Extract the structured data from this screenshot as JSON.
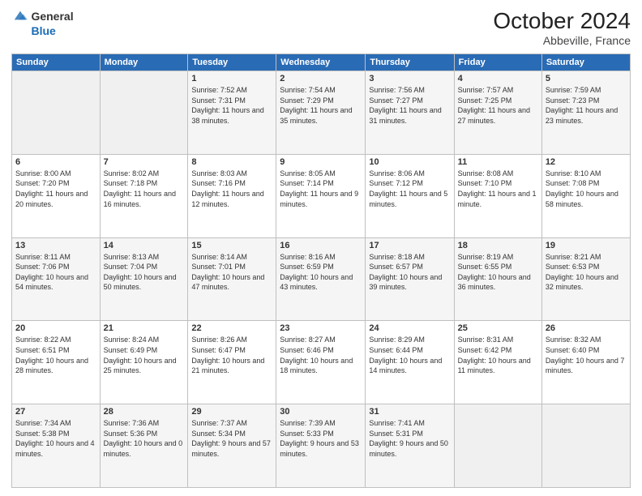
{
  "header": {
    "logo": {
      "general": "General",
      "blue": "Blue"
    },
    "title": "October 2024",
    "location": "Abbeville, France"
  },
  "days_header": [
    "Sunday",
    "Monday",
    "Tuesday",
    "Wednesday",
    "Thursday",
    "Friday",
    "Saturday"
  ],
  "weeks": [
    [
      {
        "day": "",
        "info": ""
      },
      {
        "day": "",
        "info": ""
      },
      {
        "day": "1",
        "sunrise": "Sunrise: 7:52 AM",
        "sunset": "Sunset: 7:31 PM",
        "daylight": "Daylight: 11 hours and 38 minutes."
      },
      {
        "day": "2",
        "sunrise": "Sunrise: 7:54 AM",
        "sunset": "Sunset: 7:29 PM",
        "daylight": "Daylight: 11 hours and 35 minutes."
      },
      {
        "day": "3",
        "sunrise": "Sunrise: 7:56 AM",
        "sunset": "Sunset: 7:27 PM",
        "daylight": "Daylight: 11 hours and 31 minutes."
      },
      {
        "day": "4",
        "sunrise": "Sunrise: 7:57 AM",
        "sunset": "Sunset: 7:25 PM",
        "daylight": "Daylight: 11 hours and 27 minutes."
      },
      {
        "day": "5",
        "sunrise": "Sunrise: 7:59 AM",
        "sunset": "Sunset: 7:23 PM",
        "daylight": "Daylight: 11 hours and 23 minutes."
      }
    ],
    [
      {
        "day": "6",
        "sunrise": "Sunrise: 8:00 AM",
        "sunset": "Sunset: 7:20 PM",
        "daylight": "Daylight: 11 hours and 20 minutes."
      },
      {
        "day": "7",
        "sunrise": "Sunrise: 8:02 AM",
        "sunset": "Sunset: 7:18 PM",
        "daylight": "Daylight: 11 hours and 16 minutes."
      },
      {
        "day": "8",
        "sunrise": "Sunrise: 8:03 AM",
        "sunset": "Sunset: 7:16 PM",
        "daylight": "Daylight: 11 hours and 12 minutes."
      },
      {
        "day": "9",
        "sunrise": "Sunrise: 8:05 AM",
        "sunset": "Sunset: 7:14 PM",
        "daylight": "Daylight: 11 hours and 9 minutes."
      },
      {
        "day": "10",
        "sunrise": "Sunrise: 8:06 AM",
        "sunset": "Sunset: 7:12 PM",
        "daylight": "Daylight: 11 hours and 5 minutes."
      },
      {
        "day": "11",
        "sunrise": "Sunrise: 8:08 AM",
        "sunset": "Sunset: 7:10 PM",
        "daylight": "Daylight: 11 hours and 1 minute."
      },
      {
        "day": "12",
        "sunrise": "Sunrise: 8:10 AM",
        "sunset": "Sunset: 7:08 PM",
        "daylight": "Daylight: 10 hours and 58 minutes."
      }
    ],
    [
      {
        "day": "13",
        "sunrise": "Sunrise: 8:11 AM",
        "sunset": "Sunset: 7:06 PM",
        "daylight": "Daylight: 10 hours and 54 minutes."
      },
      {
        "day": "14",
        "sunrise": "Sunrise: 8:13 AM",
        "sunset": "Sunset: 7:04 PM",
        "daylight": "Daylight: 10 hours and 50 minutes."
      },
      {
        "day": "15",
        "sunrise": "Sunrise: 8:14 AM",
        "sunset": "Sunset: 7:01 PM",
        "daylight": "Daylight: 10 hours and 47 minutes."
      },
      {
        "day": "16",
        "sunrise": "Sunrise: 8:16 AM",
        "sunset": "Sunset: 6:59 PM",
        "daylight": "Daylight: 10 hours and 43 minutes."
      },
      {
        "day": "17",
        "sunrise": "Sunrise: 8:18 AM",
        "sunset": "Sunset: 6:57 PM",
        "daylight": "Daylight: 10 hours and 39 minutes."
      },
      {
        "day": "18",
        "sunrise": "Sunrise: 8:19 AM",
        "sunset": "Sunset: 6:55 PM",
        "daylight": "Daylight: 10 hours and 36 minutes."
      },
      {
        "day": "19",
        "sunrise": "Sunrise: 8:21 AM",
        "sunset": "Sunset: 6:53 PM",
        "daylight": "Daylight: 10 hours and 32 minutes."
      }
    ],
    [
      {
        "day": "20",
        "sunrise": "Sunrise: 8:22 AM",
        "sunset": "Sunset: 6:51 PM",
        "daylight": "Daylight: 10 hours and 28 minutes."
      },
      {
        "day": "21",
        "sunrise": "Sunrise: 8:24 AM",
        "sunset": "Sunset: 6:49 PM",
        "daylight": "Daylight: 10 hours and 25 minutes."
      },
      {
        "day": "22",
        "sunrise": "Sunrise: 8:26 AM",
        "sunset": "Sunset: 6:47 PM",
        "daylight": "Daylight: 10 hours and 21 minutes."
      },
      {
        "day": "23",
        "sunrise": "Sunrise: 8:27 AM",
        "sunset": "Sunset: 6:46 PM",
        "daylight": "Daylight: 10 hours and 18 minutes."
      },
      {
        "day": "24",
        "sunrise": "Sunrise: 8:29 AM",
        "sunset": "Sunset: 6:44 PM",
        "daylight": "Daylight: 10 hours and 14 minutes."
      },
      {
        "day": "25",
        "sunrise": "Sunrise: 8:31 AM",
        "sunset": "Sunset: 6:42 PM",
        "daylight": "Daylight: 10 hours and 11 minutes."
      },
      {
        "day": "26",
        "sunrise": "Sunrise: 8:32 AM",
        "sunset": "Sunset: 6:40 PM",
        "daylight": "Daylight: 10 hours and 7 minutes."
      }
    ],
    [
      {
        "day": "27",
        "sunrise": "Sunrise: 7:34 AM",
        "sunset": "Sunset: 5:38 PM",
        "daylight": "Daylight: 10 hours and 4 minutes."
      },
      {
        "day": "28",
        "sunrise": "Sunrise: 7:36 AM",
        "sunset": "Sunset: 5:36 PM",
        "daylight": "Daylight: 10 hours and 0 minutes."
      },
      {
        "day": "29",
        "sunrise": "Sunrise: 7:37 AM",
        "sunset": "Sunset: 5:34 PM",
        "daylight": "Daylight: 9 hours and 57 minutes."
      },
      {
        "day": "30",
        "sunrise": "Sunrise: 7:39 AM",
        "sunset": "Sunset: 5:33 PM",
        "daylight": "Daylight: 9 hours and 53 minutes."
      },
      {
        "day": "31",
        "sunrise": "Sunrise: 7:41 AM",
        "sunset": "Sunset: 5:31 PM",
        "daylight": "Daylight: 9 hours and 50 minutes."
      },
      {
        "day": "",
        "info": ""
      },
      {
        "day": "",
        "info": ""
      }
    ]
  ]
}
